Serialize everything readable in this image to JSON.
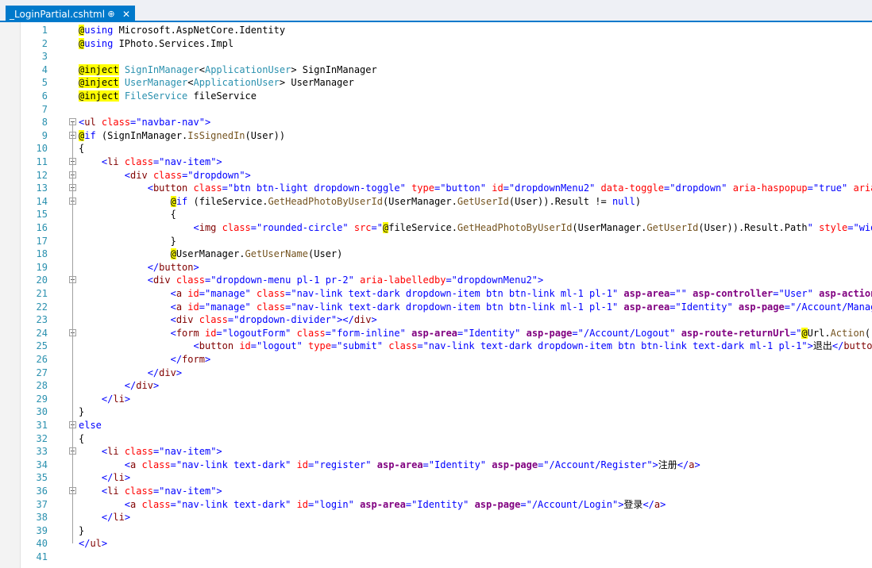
{
  "tab": {
    "title": "_LoginPartial.cshtml",
    "pin": "⊕",
    "close": "✕"
  },
  "colors": {
    "keyword": "#0000ff",
    "tag": "#800000",
    "attr": "#ff0000",
    "string": "#0000ff",
    "type": "#2b91af",
    "method": "#74531f",
    "razor_bg": "#ffff00",
    "server_bg": "#f0f0f0",
    "tagHelperAttr": "#800080"
  },
  "code_lines": [
    [
      [
        "hl",
        "@"
      ],
      [
        "k",
        "using"
      ],
      [
        "t",
        " Microsoft.AspNetCore.Identity"
      ]
    ],
    [
      [
        "hl",
        "@"
      ],
      [
        "k",
        "using"
      ],
      [
        "t",
        " IPhoto.Services.Impl"
      ]
    ],
    [],
    [
      [
        "hl",
        "@inject"
      ],
      [
        "t",
        " "
      ],
      [
        "ty",
        "SignInManager"
      ],
      [
        "t",
        "<"
      ],
      [
        "ty",
        "ApplicationUser"
      ],
      [
        "t",
        "> SignInManager"
      ]
    ],
    [
      [
        "hl",
        "@inject"
      ],
      [
        "t",
        " "
      ],
      [
        "ty",
        "UserManager"
      ],
      [
        "t",
        "<"
      ],
      [
        "ty",
        "ApplicationUser"
      ],
      [
        "t",
        "> UserManager"
      ]
    ],
    [
      [
        "hl",
        "@inject"
      ],
      [
        "t",
        " "
      ],
      [
        "ty",
        "FileService"
      ],
      [
        "t",
        " fileService"
      ]
    ],
    [],
    [
      [
        "k",
        "<"
      ],
      [
        "tg",
        "ul"
      ],
      [
        "t",
        " "
      ],
      [
        "at",
        "class"
      ],
      [
        "k",
        "=\"navbar-nav\">"
      ]
    ],
    [
      [
        "hl",
        "@"
      ],
      [
        "k",
        "if"
      ],
      [
        "t",
        " (SignInManager."
      ],
      [
        "m",
        "IsSignedIn"
      ],
      [
        "t",
        "(User))"
      ]
    ],
    [
      [
        "t",
        "{"
      ]
    ],
    [
      [
        "t",
        "    "
      ],
      [
        "k",
        "<"
      ],
      [
        "tg",
        "li"
      ],
      [
        "t",
        " "
      ],
      [
        "at",
        "class"
      ],
      [
        "k",
        "=\"nav-item\">"
      ]
    ],
    [
      [
        "t",
        "        "
      ],
      [
        "k",
        "<"
      ],
      [
        "tg",
        "div"
      ],
      [
        "t",
        " "
      ],
      [
        "at",
        "class"
      ],
      [
        "k",
        "=\"dropdown\">"
      ]
    ],
    [
      [
        "t",
        "            "
      ],
      [
        "k",
        "<"
      ],
      [
        "tg",
        "button"
      ],
      [
        "t",
        " "
      ],
      [
        "at",
        "class"
      ],
      [
        "k",
        "=\"btn btn-light dropdown-toggle\""
      ],
      [
        "t",
        " "
      ],
      [
        "at",
        "type"
      ],
      [
        "k",
        "=\"button\""
      ],
      [
        "t",
        " "
      ],
      [
        "at",
        "id"
      ],
      [
        "k",
        "=\"dropdownMenu2\""
      ],
      [
        "t",
        " "
      ],
      [
        "at",
        "data-toggle"
      ],
      [
        "k",
        "=\"dropdown\""
      ],
      [
        "t",
        " "
      ],
      [
        "at",
        "aria-haspopup"
      ],
      [
        "k",
        "=\"true\""
      ],
      [
        "t",
        " "
      ],
      [
        "at",
        "aria-expanded"
      ]
    ],
    [
      [
        "t",
        "                "
      ],
      [
        "hl",
        "@"
      ],
      [
        "k",
        "if"
      ],
      [
        "t",
        " (fileService."
      ],
      [
        "m",
        "GetHeadPhotoByUserId"
      ],
      [
        "t",
        "(UserManager."
      ],
      [
        "m",
        "GetUserId"
      ],
      [
        "t",
        "(User)).Result != "
      ],
      [
        "k",
        "null"
      ],
      [
        "t",
        ")"
      ]
    ],
    [
      [
        "t",
        "                {"
      ]
    ],
    [
      [
        "t",
        "                    "
      ],
      [
        "k",
        "<"
      ],
      [
        "tg",
        "img"
      ],
      [
        "t",
        " "
      ],
      [
        "at",
        "class"
      ],
      [
        "k",
        "=\"rounded-circle\""
      ],
      [
        "t",
        " "
      ],
      [
        "at",
        "src"
      ],
      [
        "k",
        "=\""
      ],
      [
        "hl",
        "@"
      ],
      [
        "t",
        "fileService."
      ],
      [
        "m",
        "GetHeadPhotoByUserId"
      ],
      [
        "t",
        "(UserManager."
      ],
      [
        "m",
        "GetUserId"
      ],
      [
        "t",
        "(User)).Result.Path"
      ],
      [
        "k",
        "\""
      ],
      [
        "t",
        " "
      ],
      [
        "at",
        "style"
      ],
      [
        "k",
        "=\"width: 40px\""
      ]
    ],
    [
      [
        "t",
        "                }"
      ]
    ],
    [
      [
        "t",
        "                "
      ],
      [
        "hl",
        "@"
      ],
      [
        "t",
        "UserManager."
      ],
      [
        "m",
        "GetUserName"
      ],
      [
        "t",
        "(User)"
      ]
    ],
    [
      [
        "t",
        "            "
      ],
      [
        "k",
        "</"
      ],
      [
        "tg",
        "button"
      ],
      [
        "k",
        ">"
      ]
    ],
    [
      [
        "t",
        "            "
      ],
      [
        "k",
        "<"
      ],
      [
        "tg",
        "div"
      ],
      [
        "t",
        " "
      ],
      [
        "at",
        "class"
      ],
      [
        "k",
        "=\"dropdown-menu pl-1 pr-2\""
      ],
      [
        "t",
        " "
      ],
      [
        "at",
        "aria-labelledby"
      ],
      [
        "k",
        "=\"dropdownMenu2\">"
      ]
    ],
    [
      [
        "t",
        "                "
      ],
      [
        "k",
        "<"
      ],
      [
        "tg",
        "a"
      ],
      [
        "t",
        " "
      ],
      [
        "at",
        "id"
      ],
      [
        "k",
        "=\"manage\""
      ],
      [
        "t",
        " "
      ],
      [
        "at",
        "class"
      ],
      [
        "k",
        "=\"nav-link text-dark dropdown-item btn btn-link ml-1 pl-1\""
      ],
      [
        "t",
        " "
      ],
      [
        "th",
        "asp-area"
      ],
      [
        "k",
        "=\"\""
      ],
      [
        "t",
        " "
      ],
      [
        "th",
        "asp-controller"
      ],
      [
        "k",
        "=\"User\""
      ],
      [
        "t",
        " "
      ],
      [
        "th",
        "asp-action"
      ],
      [
        "k",
        "=\"Index\""
      ]
    ],
    [
      [
        "t",
        "                "
      ],
      [
        "k",
        "<"
      ],
      [
        "tg",
        "a"
      ],
      [
        "t",
        " "
      ],
      [
        "at",
        "id"
      ],
      [
        "k",
        "=\"manage\""
      ],
      [
        "t",
        " "
      ],
      [
        "at",
        "class"
      ],
      [
        "k",
        "=\"nav-link text-dark dropdown-item btn btn-link ml-1 pl-1\""
      ],
      [
        "t",
        " "
      ],
      [
        "th",
        "asp-area"
      ],
      [
        "k",
        "=\"Identity\""
      ],
      [
        "t",
        " "
      ],
      [
        "th",
        "asp-page"
      ],
      [
        "k",
        "=\"/Account/Manage/Index\""
      ]
    ],
    [
      [
        "t",
        "                "
      ],
      [
        "k",
        "<"
      ],
      [
        "tg",
        "div"
      ],
      [
        "t",
        " "
      ],
      [
        "at",
        "class"
      ],
      [
        "k",
        "=\"dropdown-divider\"></"
      ],
      [
        "tg",
        "div"
      ],
      [
        "k",
        ">"
      ]
    ],
    [
      [
        "t",
        "                "
      ],
      [
        "k",
        "<"
      ],
      [
        "tg",
        "form"
      ],
      [
        "t",
        " "
      ],
      [
        "at",
        "id"
      ],
      [
        "k",
        "=\"logoutForm\""
      ],
      [
        "t",
        " "
      ],
      [
        "at",
        "class"
      ],
      [
        "k",
        "=\"form-inline\""
      ],
      [
        "t",
        " "
      ],
      [
        "th",
        "asp-area"
      ],
      [
        "k",
        "=\"Identity\""
      ],
      [
        "t",
        " "
      ],
      [
        "th",
        "asp-page"
      ],
      [
        "k",
        "=\"/Account/Logout\""
      ],
      [
        "t",
        " "
      ],
      [
        "th",
        "asp-route-returnUrl"
      ],
      [
        "k",
        "=\""
      ],
      [
        "hl",
        "@"
      ],
      [
        "t",
        "Url."
      ],
      [
        "m",
        "Action"
      ],
      [
        "t",
        "("
      ],
      [
        "k",
        "\"Index\""
      ],
      [
        "t",
        ","
      ]
    ],
    [
      [
        "t",
        "                    "
      ],
      [
        "k",
        "<"
      ],
      [
        "tg",
        "button"
      ],
      [
        "t",
        " "
      ],
      [
        "at",
        "id"
      ],
      [
        "k",
        "=\"logout\""
      ],
      [
        "t",
        " "
      ],
      [
        "at",
        "type"
      ],
      [
        "k",
        "=\"submit\""
      ],
      [
        "t",
        " "
      ],
      [
        "at",
        "class"
      ],
      [
        "k",
        "=\"nav-link text-dark dropdown-item btn btn-link text-dark ml-1 pl-1\">"
      ],
      [
        "t",
        "退出"
      ],
      [
        "k",
        "</"
      ],
      [
        "tg",
        "button"
      ],
      [
        "k",
        ">"
      ]
    ],
    [
      [
        "t",
        "                "
      ],
      [
        "k",
        "</"
      ],
      [
        "tg",
        "form"
      ],
      [
        "k",
        ">"
      ]
    ],
    [
      [
        "t",
        "            "
      ],
      [
        "k",
        "</"
      ],
      [
        "tg",
        "div"
      ],
      [
        "k",
        ">"
      ]
    ],
    [
      [
        "t",
        "        "
      ],
      [
        "k",
        "</"
      ],
      [
        "tg",
        "div"
      ],
      [
        "k",
        ">"
      ]
    ],
    [
      [
        "t",
        "    "
      ],
      [
        "k",
        "</"
      ],
      [
        "tg",
        "li"
      ],
      [
        "k",
        ">"
      ]
    ],
    [
      [
        "t",
        "}"
      ]
    ],
    [
      [
        "k",
        "else"
      ]
    ],
    [
      [
        "t",
        "{"
      ]
    ],
    [
      [
        "t",
        "    "
      ],
      [
        "k",
        "<"
      ],
      [
        "tg",
        "li"
      ],
      [
        "t",
        " "
      ],
      [
        "at",
        "class"
      ],
      [
        "k",
        "=\"nav-item\">"
      ]
    ],
    [
      [
        "t",
        "        "
      ],
      [
        "k",
        "<"
      ],
      [
        "tg",
        "a"
      ],
      [
        "t",
        " "
      ],
      [
        "at",
        "class"
      ],
      [
        "k",
        "=\"nav-link text-dark\""
      ],
      [
        "t",
        " "
      ],
      [
        "at",
        "id"
      ],
      [
        "k",
        "=\"register\""
      ],
      [
        "t",
        " "
      ],
      [
        "th",
        "asp-area"
      ],
      [
        "k",
        "=\"Identity\""
      ],
      [
        "t",
        " "
      ],
      [
        "th",
        "asp-page"
      ],
      [
        "k",
        "=\"/Account/Register\">"
      ],
      [
        "t",
        "注册"
      ],
      [
        "k",
        "</"
      ],
      [
        "tg",
        "a"
      ],
      [
        "k",
        ">"
      ]
    ],
    [
      [
        "t",
        "    "
      ],
      [
        "k",
        "</"
      ],
      [
        "tg",
        "li"
      ],
      [
        "k",
        ">"
      ]
    ],
    [
      [
        "t",
        "    "
      ],
      [
        "k",
        "<"
      ],
      [
        "tg",
        "li"
      ],
      [
        "t",
        " "
      ],
      [
        "at",
        "class"
      ],
      [
        "k",
        "=\"nav-item\">"
      ]
    ],
    [
      [
        "t",
        "        "
      ],
      [
        "k",
        "<"
      ],
      [
        "tg",
        "a"
      ],
      [
        "t",
        " "
      ],
      [
        "at",
        "class"
      ],
      [
        "k",
        "=\"nav-link text-dark\""
      ],
      [
        "t",
        " "
      ],
      [
        "at",
        "id"
      ],
      [
        "k",
        "=\"login\""
      ],
      [
        "t",
        " "
      ],
      [
        "th",
        "asp-area"
      ],
      [
        "k",
        "=\"Identity\""
      ],
      [
        "t",
        " "
      ],
      [
        "th",
        "asp-page"
      ],
      [
        "k",
        "=\"/Account/Login\">"
      ],
      [
        "t",
        "登录"
      ],
      [
        "k",
        "</"
      ],
      [
        "tg",
        "a"
      ],
      [
        "k",
        ">"
      ]
    ],
    [
      [
        "t",
        "    "
      ],
      [
        "k",
        "</"
      ],
      [
        "tg",
        "li"
      ],
      [
        "k",
        ">"
      ]
    ],
    [
      [
        "t",
        "}"
      ]
    ],
    [
      [
        "k",
        "</"
      ],
      [
        "tg",
        "ul"
      ],
      [
        "k",
        ">"
      ]
    ],
    []
  ],
  "fold_lines": [
    8,
    9,
    11,
    12,
    13,
    14,
    20,
    24,
    31,
    33,
    36
  ]
}
